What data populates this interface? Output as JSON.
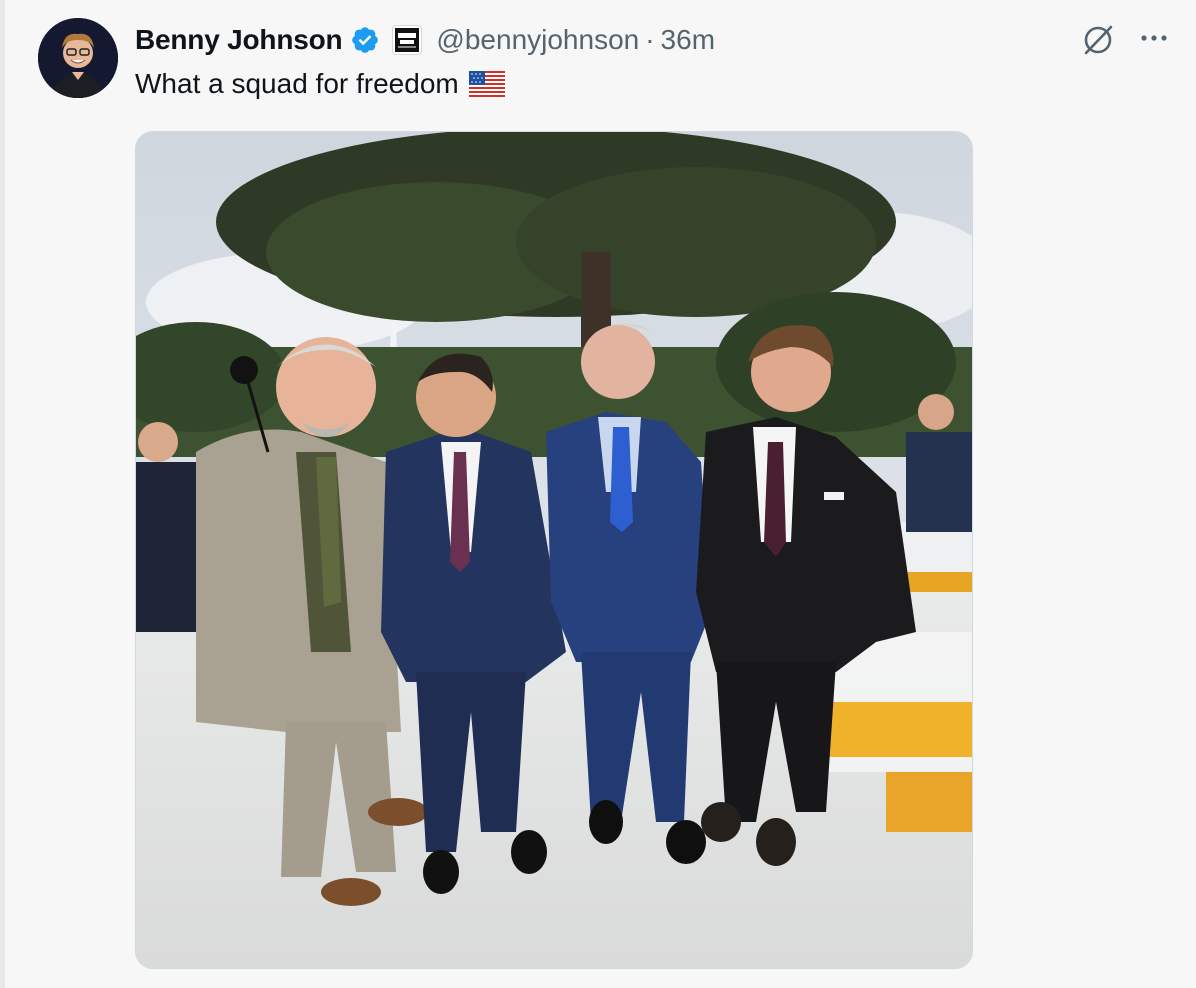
{
  "author": {
    "name": "Benny Johnson",
    "handle": "@bennyjohnson",
    "separator": "·",
    "time": "36m",
    "verified": true,
    "affiliate_badge": "BENNY SHOW",
    "avatar_icon": "profile-photo"
  },
  "post": {
    "text": "What a squad for freedom",
    "emoji": "us-flag-emoji"
  },
  "actions": {
    "grok_icon": "grok-icon",
    "more_icon": "more-icon"
  },
  "media": {
    "type": "photo"
  },
  "colors": {
    "verified_blue": "#1d9bf0",
    "text_primary": "#0f1419",
    "text_secondary": "#536471",
    "border": "#cfd9de",
    "background": "#f7f7f7"
  }
}
